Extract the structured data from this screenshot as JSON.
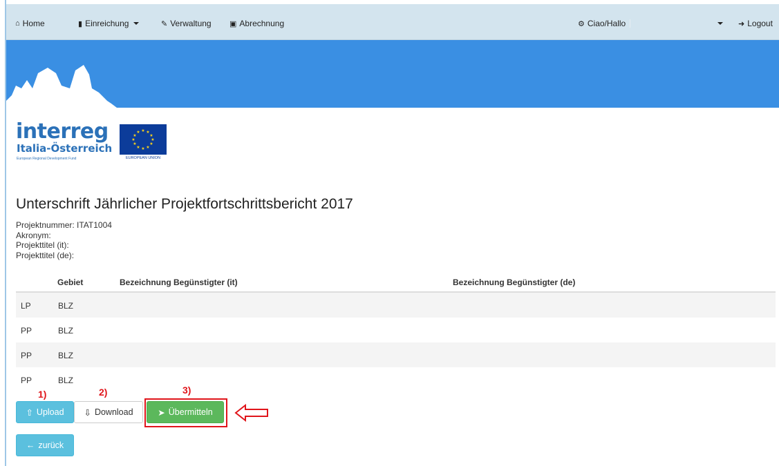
{
  "nav": {
    "home": "Home",
    "einreichung": "Einreichung",
    "verwaltung": "Verwaltung",
    "abrechnung": "Abrechnung",
    "greeting": "Ciao/Hallo",
    "logout": "Logout"
  },
  "logo": {
    "word": "interreg",
    "region": "Italia-Österreich",
    "fund": "European Regional Development Fund",
    "eu": "EUROPEAN UNION"
  },
  "page": {
    "title": "Unterschrift Jährlicher Projektfortschrittsbericht 2017",
    "projektnummer": "Projektnummer: ITAT1004",
    "akronym": "Akronym:",
    "titel_it": "Projekttitel (it):",
    "titel_de": "Projekttitel (de):"
  },
  "table": {
    "headers": [
      "",
      "Gebiet",
      "Bezeichnung Begünstigter (it)",
      "Bezeichnung Begünstigter (de)"
    ],
    "rows": [
      [
        "LP",
        "BLZ",
        "",
        ""
      ],
      [
        "PP",
        "BLZ",
        "",
        ""
      ],
      [
        "PP",
        "BLZ",
        "",
        ""
      ],
      [
        "PP",
        "BLZ",
        "",
        ""
      ]
    ]
  },
  "steps": [
    "1)",
    "2)",
    "3)"
  ],
  "buttons": {
    "upload": "Upload",
    "download": "Download",
    "submit": "Übermitteln",
    "back": "zurück"
  },
  "colors": {
    "banner": "#3a8fe3",
    "navbar": "#d3e4ee",
    "info": "#5bc0de",
    "success": "#5cb85c",
    "annotation": "#e0141a"
  },
  "icons": {
    "home": "home-icon",
    "einreichung": "book-icon",
    "verwaltung": "pencil-icon",
    "abrechnung": "money-icon",
    "greeting": "gear-icon",
    "logout": "logout-icon",
    "upload": "upload-icon",
    "download": "download-icon",
    "submit": "send-icon",
    "back": "arrow-left-icon"
  }
}
